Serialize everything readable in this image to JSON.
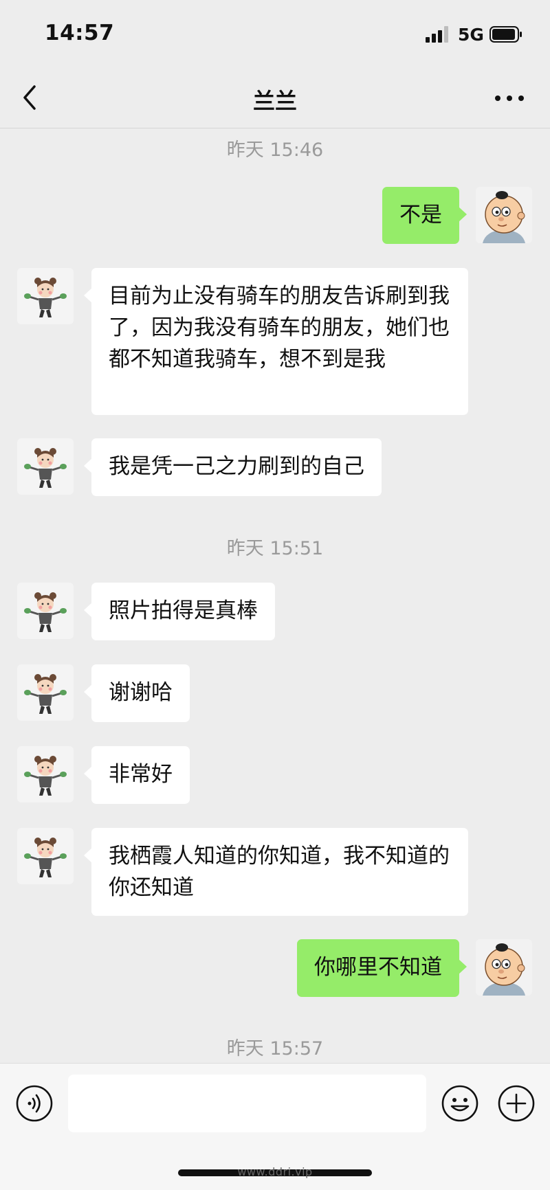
{
  "status": {
    "time": "14:57",
    "network": "5G"
  },
  "nav": {
    "title": "兰兰"
  },
  "chat": {
    "timestamps": [
      "昨天 15:46",
      "昨天 15:51",
      "昨天 15:57"
    ],
    "messages": [
      {
        "from": "me",
        "text": "不是"
      },
      {
        "from": "other",
        "text": "目前为止没有骑车的朋友告诉刷到我了，因为我没有骑车的朋友，她们也都不知道我骑车，想不到是我"
      },
      {
        "from": "other",
        "text": "我是凭一己之力刷到的自己"
      },
      {
        "from": "other",
        "text": "照片拍得是真棒"
      },
      {
        "from": "other",
        "text": "谢谢哈"
      },
      {
        "from": "other",
        "text": "非常好"
      },
      {
        "from": "other",
        "text": "我栖霞人知道的你知道，我不知道的你还知道"
      },
      {
        "from": "me",
        "text": "你哪里不知道"
      }
    ]
  },
  "input": {
    "value": "",
    "placeholder": ""
  },
  "footer": {
    "watermark": "www.ddri.vip"
  },
  "colors": {
    "background": "#ededed",
    "outgoing_bubble": "#95ec69",
    "incoming_bubble": "#ffffff",
    "timestamp": "#9a9a9a"
  },
  "icons": [
    "back-arrow-icon",
    "more-dots-icon",
    "voice-icon",
    "emoji-icon",
    "plus-icon",
    "signal-icon",
    "battery-icon"
  ]
}
